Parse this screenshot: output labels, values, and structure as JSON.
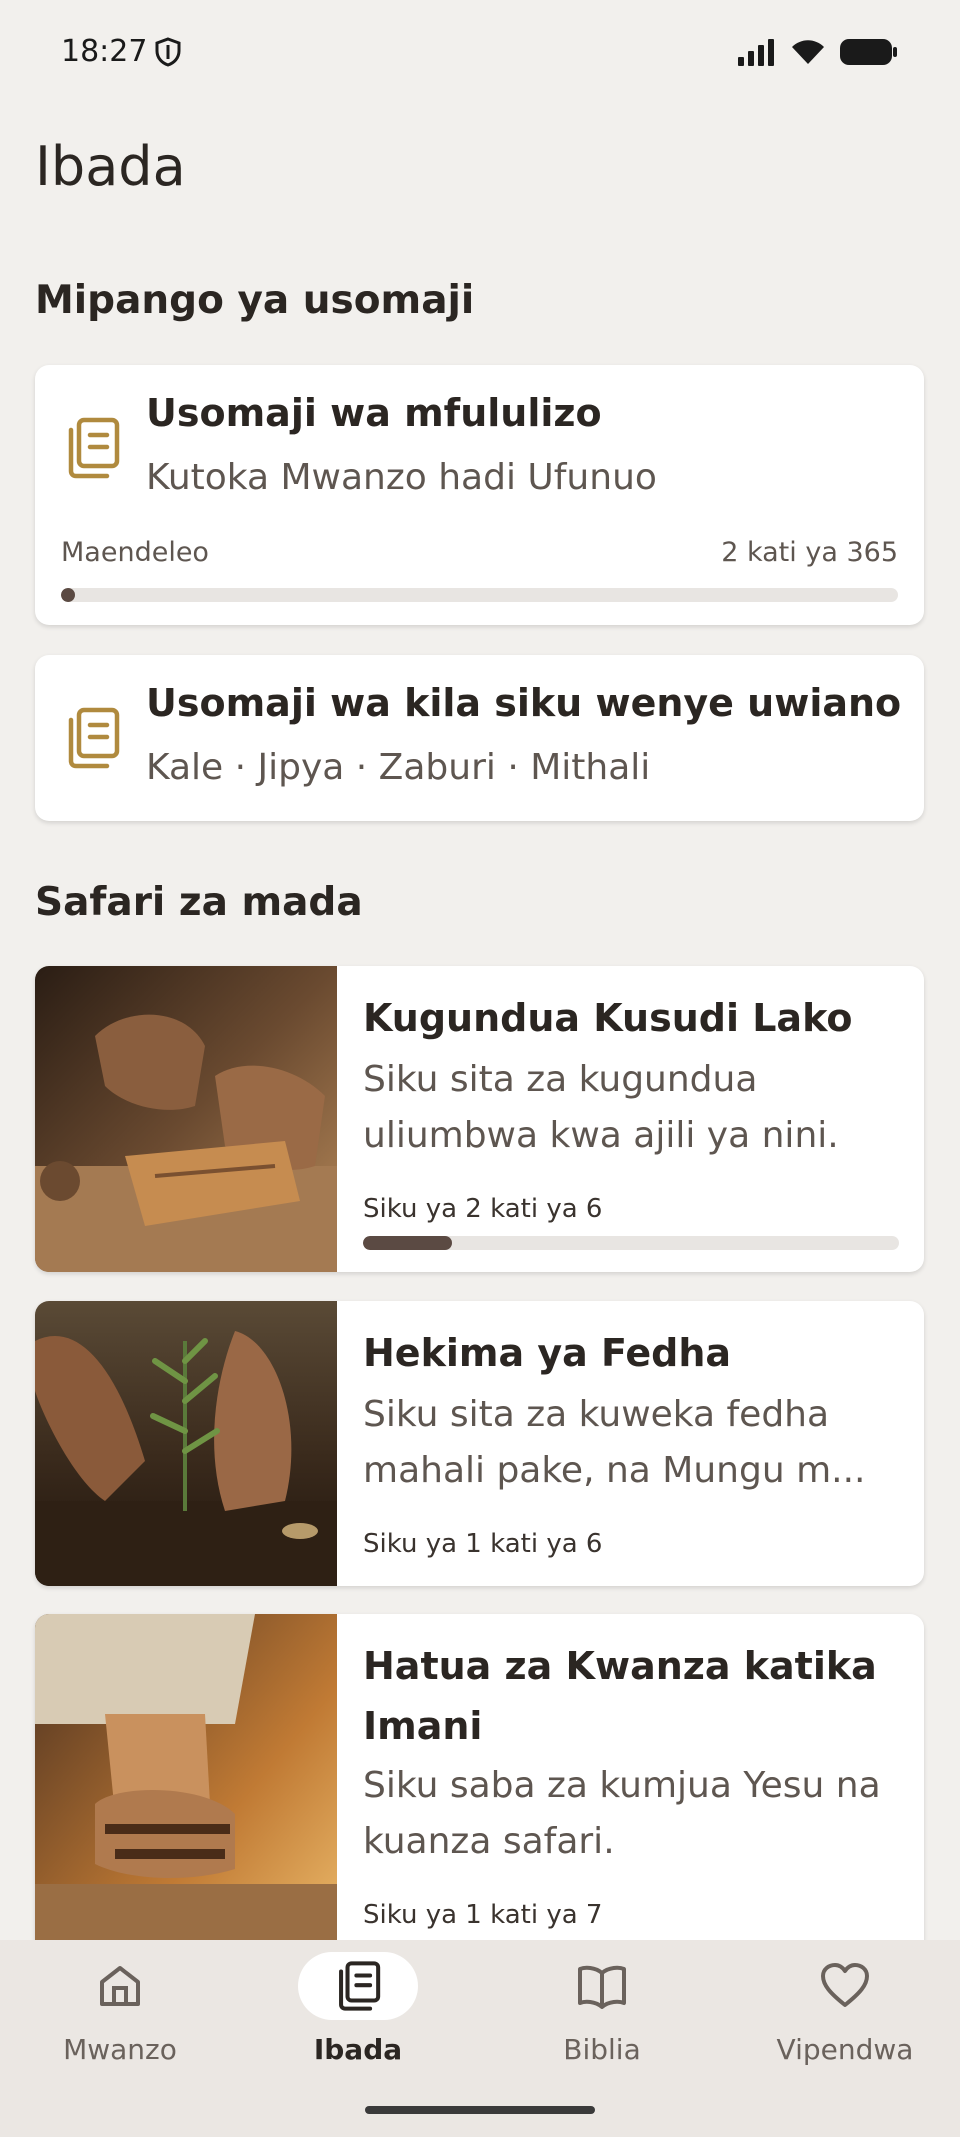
{
  "status_bar": {
    "time": "18:27"
  },
  "page": {
    "title": "Ibada"
  },
  "plans_section": {
    "title": "Mipango ya usomaji",
    "plans": [
      {
        "title": "Usomaji wa mfululizo",
        "subtitle": "Kutoka Mwanzo hadi Ufunuo",
        "progress_label": "Maendeleo",
        "progress_count": "2 kati ya 365",
        "progress_fraction": 0.0055
      },
      {
        "title": "Usomaji wa kila siku wenye uwiano",
        "subtitle": "Kale · Jipya · Zaburi · Mithali"
      }
    ]
  },
  "journeys_section": {
    "title": "Safari za mada",
    "journeys": [
      {
        "title": "Kugundua Kusudi Lako",
        "description": "Siku sita za kugundua uliumbwa kwa ajili ya nini.",
        "day_label": "Siku ya 2 kati ya 6",
        "progress_fraction": 0.1667,
        "image": "hands-carving-wood"
      },
      {
        "title": "Hekima ya Fedha",
        "description": "Siku sita za kuweka fedha mahali pake, na Mungu m...",
        "day_label": "Siku ya 1 kati ya 6",
        "image": "hands-planting-seedling"
      },
      {
        "title": "Hatua za Kwanza katika Imani",
        "description": "Siku saba za kumjua Yesu na kuanza safari.",
        "day_label": "Siku ya 1 kati ya 7",
        "image": "sandaled-foot-on-path"
      }
    ]
  },
  "bottom_nav": {
    "items": [
      {
        "label": "Mwanzo",
        "icon": "home-icon",
        "active": false
      },
      {
        "label": "Ibada",
        "icon": "devotion-books-icon",
        "active": true
      },
      {
        "label": "Biblia",
        "icon": "open-book-icon",
        "active": false
      },
      {
        "label": "Vipendwa",
        "icon": "heart-icon",
        "active": false
      }
    ]
  },
  "colors": {
    "background": "#f2f0ed",
    "accent_gold": "#b08a3e",
    "progress_fill": "#5b4a43",
    "progress_track": "#e8e5e2"
  }
}
